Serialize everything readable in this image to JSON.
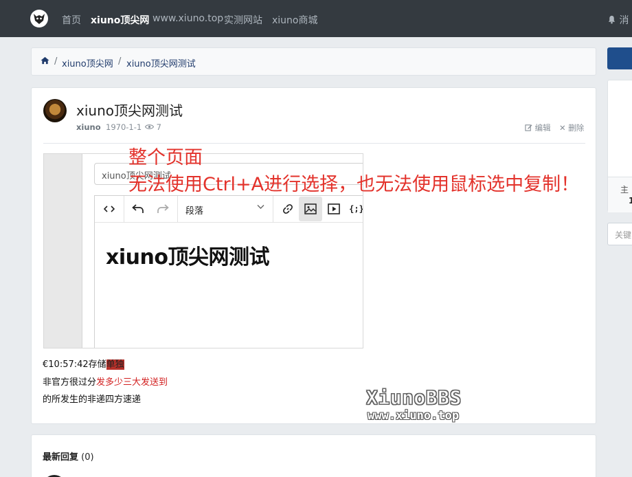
{
  "nav": {
    "links": [
      "首页",
      "xiuno顶尖网",
      "www.xiuno.top",
      "实测网站",
      "xiuno商城"
    ],
    "messages_label": "消"
  },
  "breadcrumb": [
    "xiuno顶尖网",
    "xiuno顶尖网测试"
  ],
  "thread": {
    "title": "xiuno顶尖网测试",
    "author": "xiuno",
    "date": "1970-1-1",
    "views": "7",
    "edit_label": "编辑",
    "delete_label": "删除"
  },
  "editor_shot": {
    "title_input": "xiuno顶尖网测试",
    "paragraph_select": "段落",
    "heading": "xiuno顶尖网测试"
  },
  "annotation": {
    "line1": "整个页面",
    "line2": "无法使用Ctrl+A进行选择，也无法使用鼠标选中复制！"
  },
  "content_lines": {
    "l1_a": "€10:57:42存储",
    "l1_b": "单独",
    "l2_a": "非官方很过分",
    "l2_b": "发多少三大发送到",
    "l3": "的所发生的非递四方速递"
  },
  "watermark": {
    "line1": "XiunoBBS",
    "line2": "www.xiuno.top"
  },
  "replies": {
    "label": "最新回复",
    "count": "(0)"
  },
  "sidebar": {
    "stat_label": "主",
    "stat_value": "1",
    "search_placeholder": "关键"
  }
}
